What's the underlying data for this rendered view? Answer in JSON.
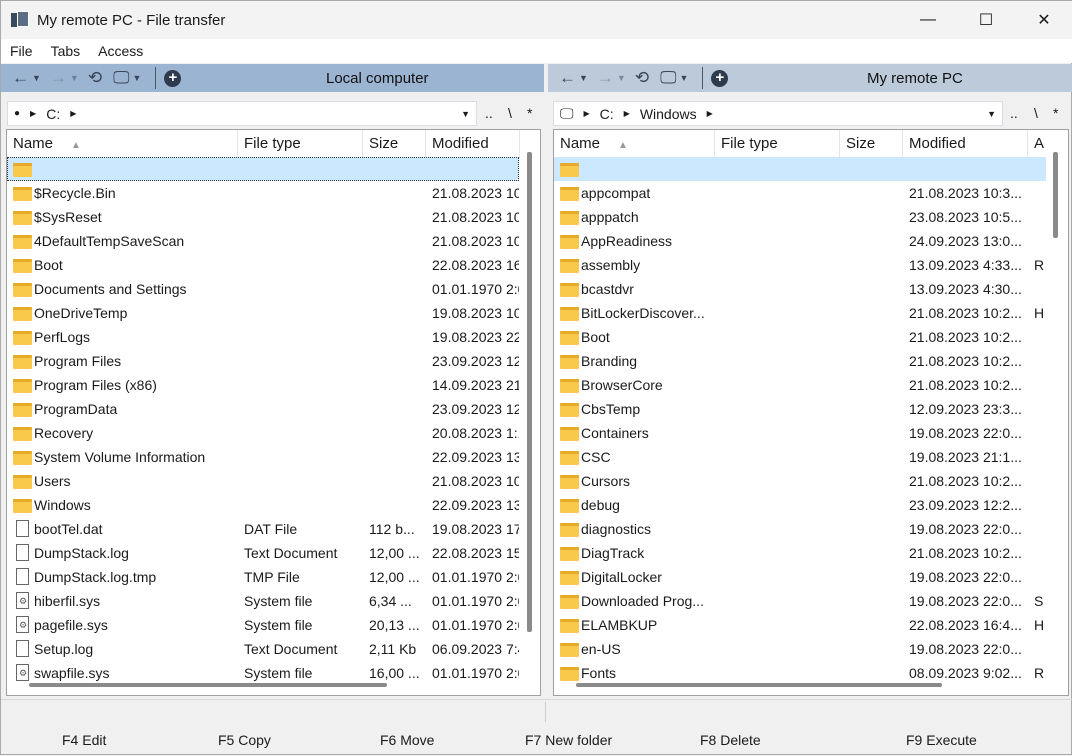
{
  "window": {
    "title": "My remote PC - File transfer",
    "controls": [
      "—",
      "☐",
      "✕"
    ]
  },
  "menu": [
    "File",
    "Tabs",
    "Access"
  ],
  "left": {
    "title": "Local computer",
    "path": [
      "C:"
    ],
    "addr_buttons": [
      "..",
      "\\",
      "*"
    ],
    "columns": [
      "Name",
      "File type",
      "Size",
      "Modified"
    ],
    "rows": [
      {
        "icon": "folder",
        "name": "",
        "type": "",
        "size": "",
        "modified": ""
      },
      {
        "icon": "folder",
        "name": "$Recycle.Bin",
        "type": "",
        "size": "",
        "modified": "21.08.2023 10"
      },
      {
        "icon": "folder",
        "name": "$SysReset",
        "type": "",
        "size": "",
        "modified": "21.08.2023 10"
      },
      {
        "icon": "folder",
        "name": "4DefaultTempSaveScan",
        "type": "",
        "size": "",
        "modified": "21.08.2023 10"
      },
      {
        "icon": "folder",
        "name": "Boot",
        "type": "",
        "size": "",
        "modified": "22.08.2023 16"
      },
      {
        "icon": "folder",
        "name": "Documents and Settings",
        "type": "",
        "size": "",
        "modified": "01.01.1970 2:0"
      },
      {
        "icon": "folder",
        "name": "OneDriveTemp",
        "type": "",
        "size": "",
        "modified": "19.08.2023 10"
      },
      {
        "icon": "folder",
        "name": "PerfLogs",
        "type": "",
        "size": "",
        "modified": "19.08.2023 22"
      },
      {
        "icon": "folder",
        "name": "Program Files",
        "type": "",
        "size": "",
        "modified": "23.09.2023 12"
      },
      {
        "icon": "folder",
        "name": "Program Files (x86)",
        "type": "",
        "size": "",
        "modified": "14.09.2023 21"
      },
      {
        "icon": "folder",
        "name": "ProgramData",
        "type": "",
        "size": "",
        "modified": "23.09.2023 12"
      },
      {
        "icon": "folder",
        "name": "Recovery",
        "type": "",
        "size": "",
        "modified": "20.08.2023 1:1"
      },
      {
        "icon": "folder",
        "name": "System Volume Information",
        "type": "",
        "size": "",
        "modified": "22.09.2023 13"
      },
      {
        "icon": "folder",
        "name": "Users",
        "type": "",
        "size": "",
        "modified": "21.08.2023 10"
      },
      {
        "icon": "folder",
        "name": "Windows",
        "type": "",
        "size": "",
        "modified": "22.09.2023 13"
      },
      {
        "icon": "file",
        "name": "bootTel.dat",
        "type": "DAT File",
        "size": "112 b...",
        "modified": "19.08.2023 17"
      },
      {
        "icon": "file",
        "name": "DumpStack.log",
        "type": "Text Document",
        "size": "12,00 ...",
        "modified": "22.08.2023 15"
      },
      {
        "icon": "file",
        "name": "DumpStack.log.tmp",
        "type": "TMP File",
        "size": "12,00 ...",
        "modified": "01.01.1970 2:0"
      },
      {
        "icon": "sys",
        "name": "hiberfil.sys",
        "type": "System file",
        "size": "6,34 ...",
        "modified": "01.01.1970 2:0"
      },
      {
        "icon": "sys",
        "name": "pagefile.sys",
        "type": "System file",
        "size": "20,13 ...",
        "modified": "01.01.1970 2:0"
      },
      {
        "icon": "file",
        "name": "Setup.log",
        "type": "Text Document",
        "size": "2,11 Kb",
        "modified": "06.09.2023 7:4"
      },
      {
        "icon": "sys",
        "name": "swapfile.sys",
        "type": "System file",
        "size": "16,00 ...",
        "modified": "01.01.1970 2:0"
      }
    ]
  },
  "right": {
    "title": "My remote PC",
    "path": [
      "C:",
      "Windows"
    ],
    "addr_buttons": [
      "..",
      "\\",
      "*"
    ],
    "columns": [
      "Name",
      "File type",
      "Size",
      "Modified",
      "A"
    ],
    "rows": [
      {
        "icon": "folder",
        "name": "",
        "modified": "",
        "attr": ""
      },
      {
        "icon": "folder",
        "name": "appcompat",
        "modified": "21.08.2023 10:3...",
        "attr": ""
      },
      {
        "icon": "folder",
        "name": "apppatch",
        "modified": "23.08.2023 10:5...",
        "attr": ""
      },
      {
        "icon": "folder",
        "name": "AppReadiness",
        "modified": "24.09.2023 13:0...",
        "attr": ""
      },
      {
        "icon": "folder",
        "name": "assembly",
        "modified": "13.09.2023 4:33...",
        "attr": "R"
      },
      {
        "icon": "folder",
        "name": "bcastdvr",
        "modified": "13.09.2023 4:30...",
        "attr": ""
      },
      {
        "icon": "folder",
        "name": "BitLockerDiscover...",
        "modified": "21.08.2023 10:2...",
        "attr": "H"
      },
      {
        "icon": "folder",
        "name": "Boot",
        "modified": "21.08.2023 10:2...",
        "attr": ""
      },
      {
        "icon": "folder",
        "name": "Branding",
        "modified": "21.08.2023 10:2...",
        "attr": ""
      },
      {
        "icon": "folder",
        "name": "BrowserCore",
        "modified": "21.08.2023 10:2...",
        "attr": ""
      },
      {
        "icon": "folder",
        "name": "CbsTemp",
        "modified": "12.09.2023 23:3...",
        "attr": ""
      },
      {
        "icon": "folder",
        "name": "Containers",
        "modified": "19.08.2023 22:0...",
        "attr": ""
      },
      {
        "icon": "folder",
        "name": "CSC",
        "modified": "19.08.2023 21:1...",
        "attr": ""
      },
      {
        "icon": "folder",
        "name": "Cursors",
        "modified": "21.08.2023 10:2...",
        "attr": ""
      },
      {
        "icon": "folder",
        "name": "debug",
        "modified": "23.09.2023 12:2...",
        "attr": ""
      },
      {
        "icon": "folder",
        "name": "diagnostics",
        "modified": "19.08.2023 22:0...",
        "attr": ""
      },
      {
        "icon": "folder",
        "name": "DiagTrack",
        "modified": "21.08.2023 10:2...",
        "attr": ""
      },
      {
        "icon": "folder",
        "name": "DigitalLocker",
        "modified": "19.08.2023 22:0...",
        "attr": ""
      },
      {
        "icon": "folder",
        "name": "Downloaded Prog...",
        "modified": "19.08.2023 22:0...",
        "attr": "S"
      },
      {
        "icon": "folder",
        "name": "ELAMBKUP",
        "modified": "22.08.2023 16:4...",
        "attr": "H"
      },
      {
        "icon": "folder",
        "name": "en-US",
        "modified": "19.08.2023 22:0...",
        "attr": ""
      },
      {
        "icon": "folder",
        "name": "Fonts",
        "modified": "08.09.2023 9:02...",
        "attr": "R"
      }
    ]
  },
  "function_keys": [
    "F4 Edit",
    "F5 Copy",
    "F6 Move",
    "F7 New folder",
    "F8 Delete",
    "F9 Execute"
  ],
  "colors": {
    "left_header": "#9bb4d2",
    "right_header": "#bccad9",
    "selection": "#cce8ff",
    "folder": "#f8c94a"
  }
}
